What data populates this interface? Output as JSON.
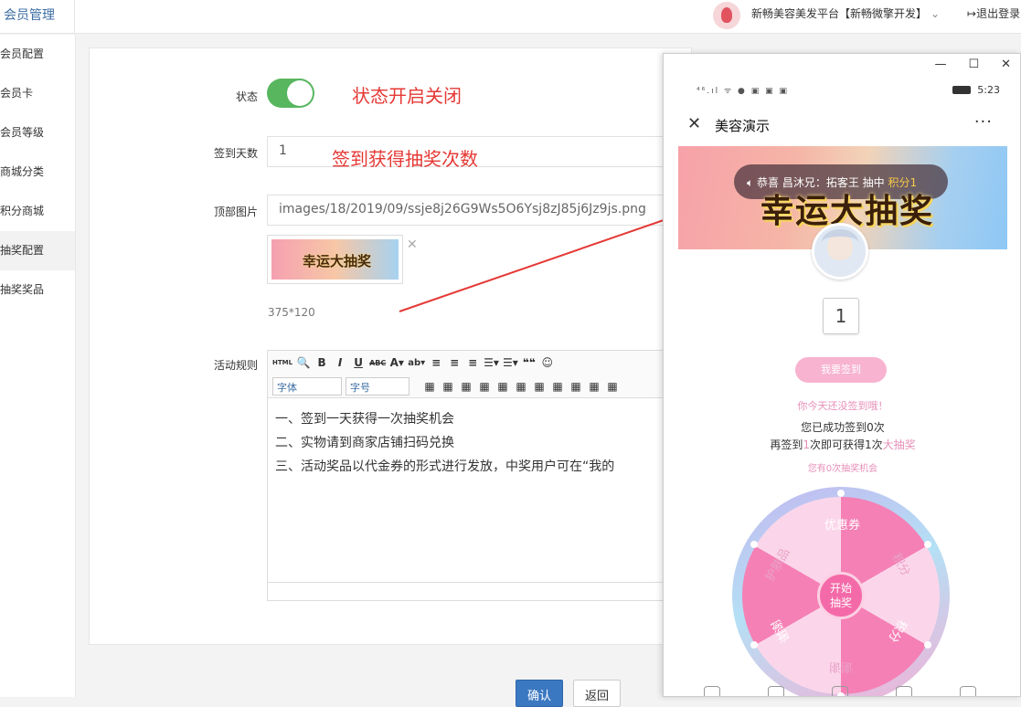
{
  "header": {
    "brand": "会员管理",
    "org_name": "新畅美容美发平台【新畅微擎开发】",
    "org_chevron": "⌄",
    "logout": "退出登录"
  },
  "sidebar": {
    "items": [
      {
        "label": "会员配置"
      },
      {
        "label": "会员卡"
      },
      {
        "label": "会员等级"
      },
      {
        "label": "商城分类"
      },
      {
        "label": "积分商城"
      },
      {
        "label": "抽奖配置",
        "active": true
      },
      {
        "label": "抽奖奖品"
      }
    ]
  },
  "form": {
    "status_label": "状态",
    "status_on": true,
    "status_annot": "状态开启关闭",
    "signin_days_label": "签到天数",
    "signin_days_value": "1",
    "signin_days_annot": "签到获得抽奖次数",
    "top_image_label": "顶部图片",
    "top_image_value": "images/18/2019/09/ssje8j26G9Ws5O6Ysj8zJ85j6Jz9js.png",
    "thumb_text": "幸运大抽奖",
    "remove": "✕",
    "size_hint": "375*120",
    "rules_label": "活动规则",
    "editor": {
      "toolbar1": [
        "HTML",
        "🔍",
        "B",
        "I",
        "U",
        "ABC",
        "A▾",
        "ab▾",
        "≡",
        "≡",
        "≡",
        "☰▾",
        "☰▾",
        "❝❝",
        "☺"
      ],
      "font_placeholder": "字体",
      "size_placeholder": "字号",
      "toolbar2": [
        "▦",
        "▦",
        "▦",
        "▦",
        "▦",
        "▦",
        "▦",
        "▦",
        "▦",
        "▦",
        "▦"
      ],
      "lines": [
        "一、签到一天获得一次抽奖机会",
        "二、实物请到商家店铺扫码兑换",
        "三、活动奖品以代金券的形式进行发放，中奖用户可在“我的"
      ]
    },
    "confirm": "确认",
    "back": "返回"
  },
  "phone": {
    "win_controls": [
      "—",
      "☐",
      "✕"
    ],
    "signal": "⁴⁶.ıl ᯤ ● ▣ ▣ ▣",
    "time": "5:23",
    "nav_title": "美容演示",
    "nav_close": "✕",
    "nav_more": "···",
    "notice_prefix": "恭喜 昌沐兄：拓客王 抽中 ",
    "notice_gold": "积分1",
    "banner_title": "幸运大抽奖",
    "count": "1",
    "signin_button": "我要签到",
    "tip_not_signed": "你今天还没签到哦！",
    "signed_days": "您已成功签到0次",
    "again_prefix": "再签到",
    "again_num": "1",
    "again_mid": "次即可获得1次",
    "again_suffix": "大抽奖",
    "chances": "您有0次抽奖机会",
    "wheel": {
      "prizes": [
        "优惠券",
        "积分",
        "积分",
        "谢谢",
        "谢谢",
        "护肤品"
      ],
      "center": [
        "开始",
        "抽奖"
      ]
    }
  },
  "colors": {
    "accent": "#58b65f",
    "annotation": "#e53935",
    "primary_button": "#3b78c2",
    "wheel_pink": "#f580b5"
  }
}
